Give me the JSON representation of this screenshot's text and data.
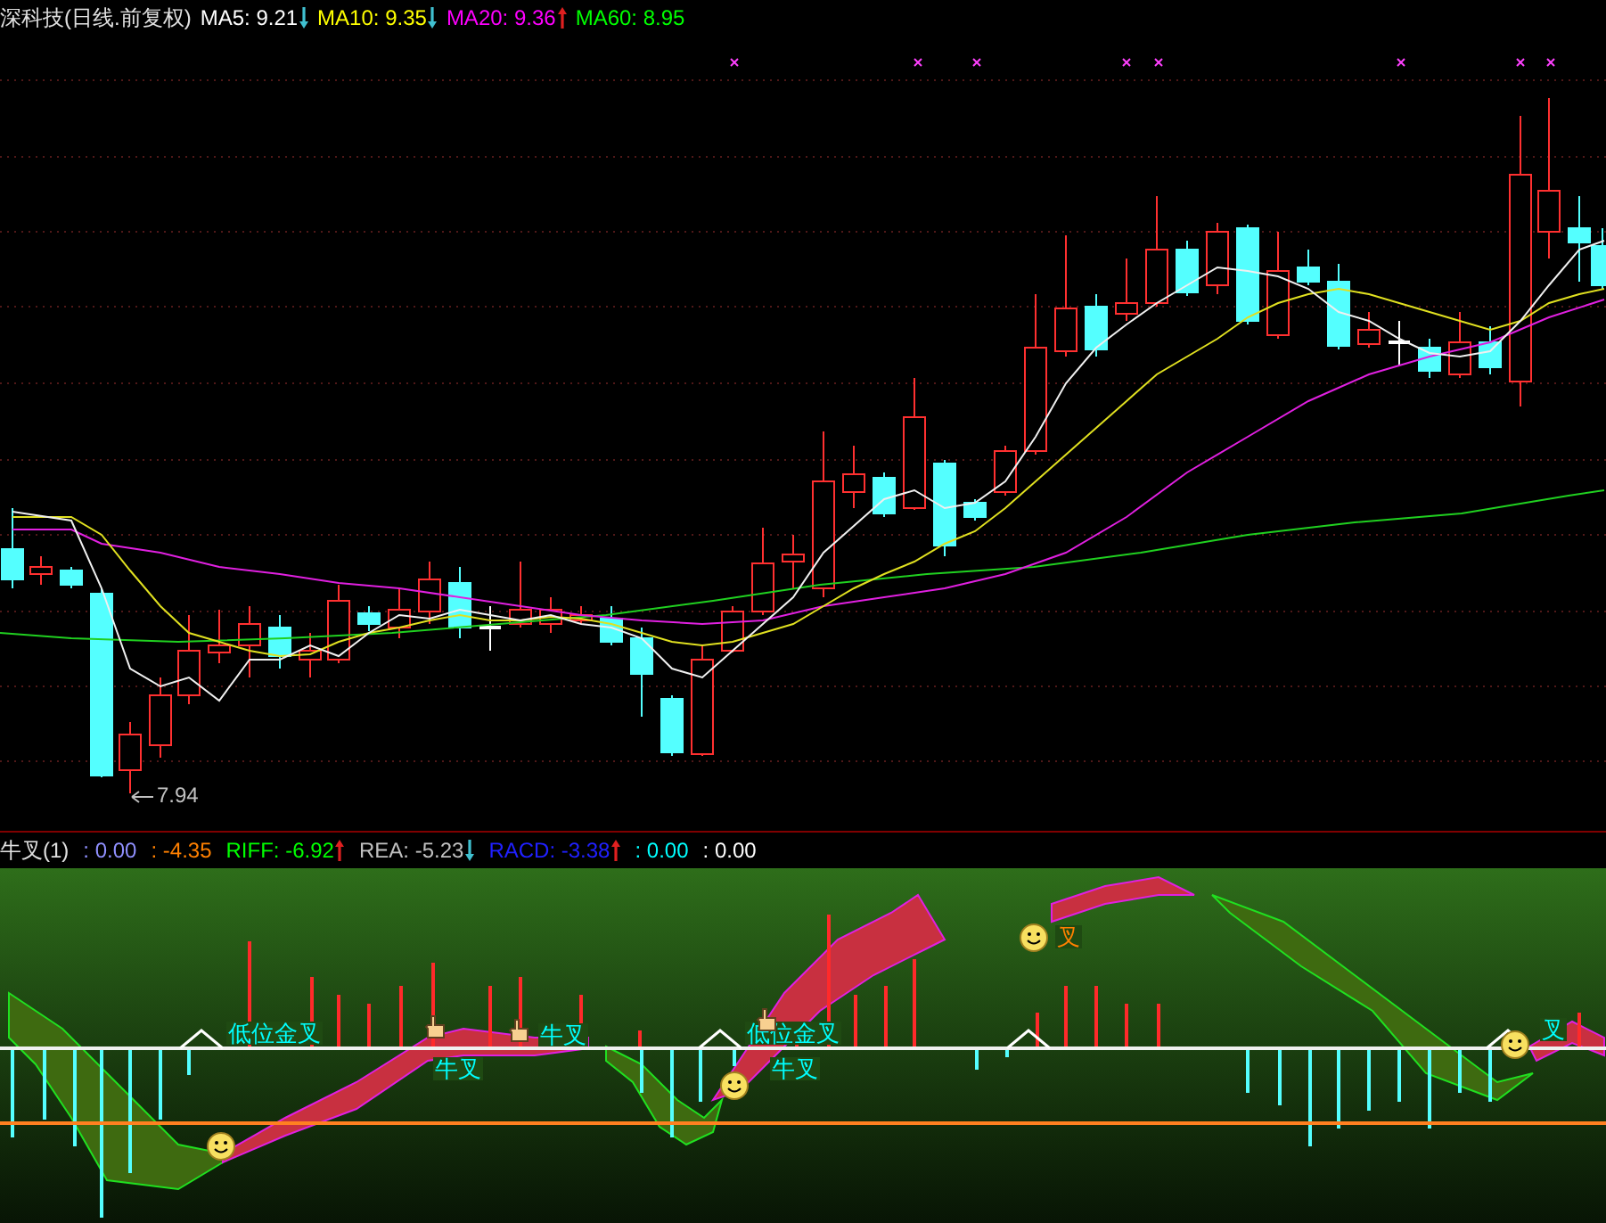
{
  "price_panel": {
    "title": "深科技(日线.前复权)",
    "indicators": [
      {
        "label": "MA5:",
        "value": "9.21",
        "color": "#ffffff",
        "kind": "falling"
      },
      {
        "label": "MA10:",
        "value": "9.35",
        "color": "#ffff00",
        "kind": "falling"
      },
      {
        "label": "MA20:",
        "value": "9.36",
        "color": "#ff00ff",
        "kind": "rising"
      },
      {
        "label": "MA60:",
        "value": "8.95",
        "color": "#00ff00",
        "kind": "plain"
      }
    ],
    "low_marker": "7.94"
  },
  "indicator_panel": {
    "title": "牛叉(1)",
    "readings": [
      {
        "label": ":",
        "value": "0.00",
        "color": "#9090ff",
        "kind": "plain"
      },
      {
        "label": ":",
        "value": "-4.35",
        "color": "#ff8000",
        "kind": "plain"
      },
      {
        "label": "RIFF:",
        "value": "-6.92",
        "color": "#00ff00",
        "kind": "rising"
      },
      {
        "label": "REA:",
        "value": "-5.23",
        "color": "#c0c0c0",
        "kind": "falling"
      },
      {
        "label": "RACD:",
        "value": "-3.38",
        "color": "#2020ff",
        "kind": "rising"
      },
      {
        "label": ":",
        "value": "0.00",
        "color": "#00ffff",
        "kind": "plain"
      },
      {
        "label": ":",
        "value": "0.00",
        "color": "#ffffff",
        "kind": "plain"
      }
    ],
    "signals": [
      {
        "text": "低位金叉",
        "color": "#00ffff"
      },
      {
        "text": "牛叉",
        "color": "#00ffff"
      },
      {
        "text": "牛叉",
        "color": "#00ffff"
      },
      {
        "text": "低位金叉",
        "color": "#00ffff"
      },
      {
        "text": "牛叉",
        "color": "#00ffff"
      },
      {
        "text": "叉",
        "color": "#ff8000"
      },
      {
        "text": "叉",
        "color": "#00ffff"
      }
    ]
  }
}
